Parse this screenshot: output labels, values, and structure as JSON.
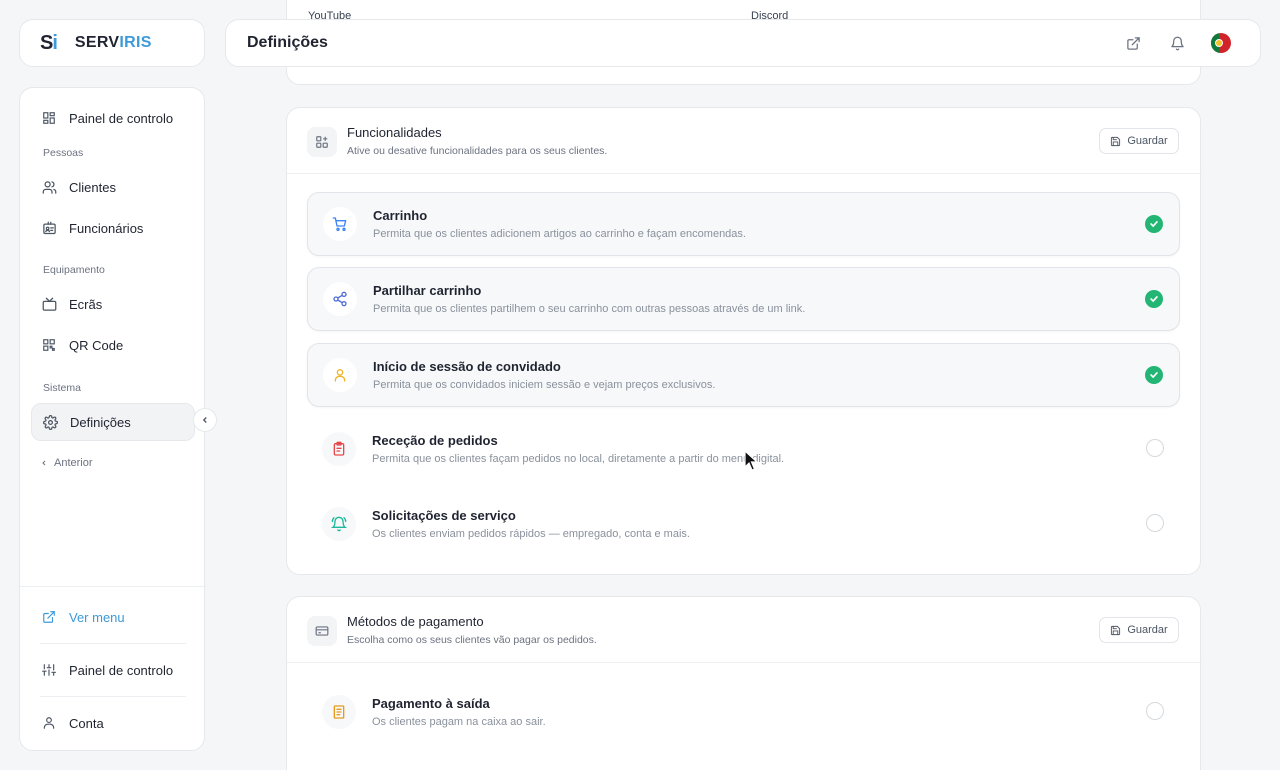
{
  "logo": {
    "mark_s": "S",
    "mark_i": "i",
    "name_a": "SERV",
    "name_b": "IRIS"
  },
  "topbar": {
    "title": "Definições"
  },
  "sidebar": {
    "dashboard": "Painel de controlo",
    "group_people": "Pessoas",
    "clients": "Clientes",
    "employees": "Funcionários",
    "group_equipment": "Equipamento",
    "screens": "Ecrãs",
    "qrcode": "QR Code",
    "group_system": "Sistema",
    "settings": "Definições",
    "back": "Anterior",
    "view_menu": "Ver menu",
    "control_panel": "Painel de controlo",
    "account": "Conta"
  },
  "social": {
    "youtube": "YouTube",
    "discord": "Discord"
  },
  "features_section": {
    "title": "Funcionalidades",
    "desc": "Ative ou desative funcionalidades para os seus clientes.",
    "save": "Guardar",
    "items": [
      {
        "title": "Carrinho",
        "desc": "Permita que os clientes adicionem artigos ao carrinho e façam encomendas.",
        "enabled": true,
        "icon": "cart-icon",
        "color": "#3b82f6"
      },
      {
        "title": "Partilhar carrinho",
        "desc": "Permita que os clientes partilhem o seu carrinho com outras pessoas através de um link.",
        "enabled": true,
        "icon": "share-icon",
        "color": "#4f6bd8"
      },
      {
        "title": "Início de sessão de convidado",
        "desc": "Permita que os convidados iniciem sessão e vejam preços exclusivos.",
        "enabled": true,
        "icon": "user-icon",
        "color": "#f0b429"
      },
      {
        "title": "Receção de pedidos",
        "desc": "Permita que os clientes façam pedidos no local, diretamente a partir do menu digital.",
        "enabled": false,
        "icon": "clipboard-icon",
        "color": "#e5484d"
      },
      {
        "title": "Solicitações de serviço",
        "desc": "Os clientes enviam pedidos rápidos — empregado, conta e mais.",
        "enabled": false,
        "icon": "bell-icon",
        "color": "#19b89a"
      }
    ]
  },
  "payment_section": {
    "title": "Métodos de pagamento",
    "desc": "Escolha como os seus clientes vão pagar os pedidos.",
    "save": "Guardar",
    "items": [
      {
        "title": "Pagamento à saída",
        "desc": "Os clientes pagam na caixa ao sair.",
        "enabled": false,
        "icon": "receipt-icon",
        "color": "#e69a1c"
      }
    ]
  }
}
